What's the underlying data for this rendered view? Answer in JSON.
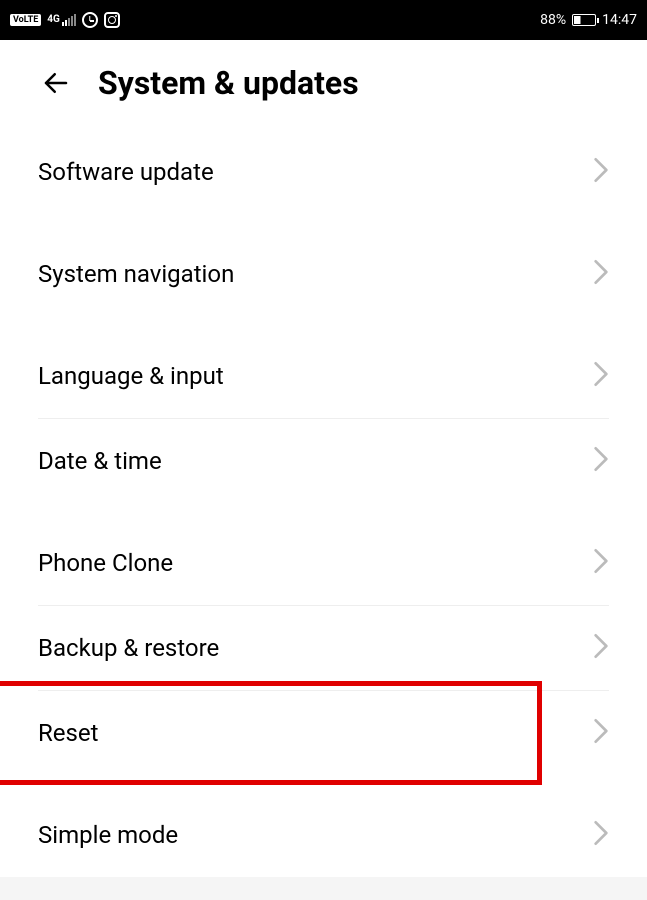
{
  "status_bar": {
    "volte": "VoLTE",
    "network": "4G",
    "battery_percent": "88%",
    "time": "14:47"
  },
  "header": {
    "title": "System & updates"
  },
  "groups": [
    {
      "items": [
        {
          "label": "Software update",
          "name": "software-update"
        }
      ]
    },
    {
      "items": [
        {
          "label": "System navigation",
          "name": "system-navigation"
        }
      ]
    },
    {
      "items": [
        {
          "label": "Language & input",
          "name": "language-input"
        },
        {
          "label": "Date & time",
          "name": "date-time"
        }
      ]
    },
    {
      "items": [
        {
          "label": "Phone Clone",
          "name": "phone-clone"
        },
        {
          "label": "Backup & restore",
          "name": "backup-restore"
        },
        {
          "label": "Reset",
          "name": "reset",
          "highlighted": true
        }
      ]
    },
    {
      "items": [
        {
          "label": "Simple mode",
          "name": "simple-mode"
        }
      ]
    }
  ],
  "highlight": {
    "color": "#e00000",
    "target": "reset"
  }
}
